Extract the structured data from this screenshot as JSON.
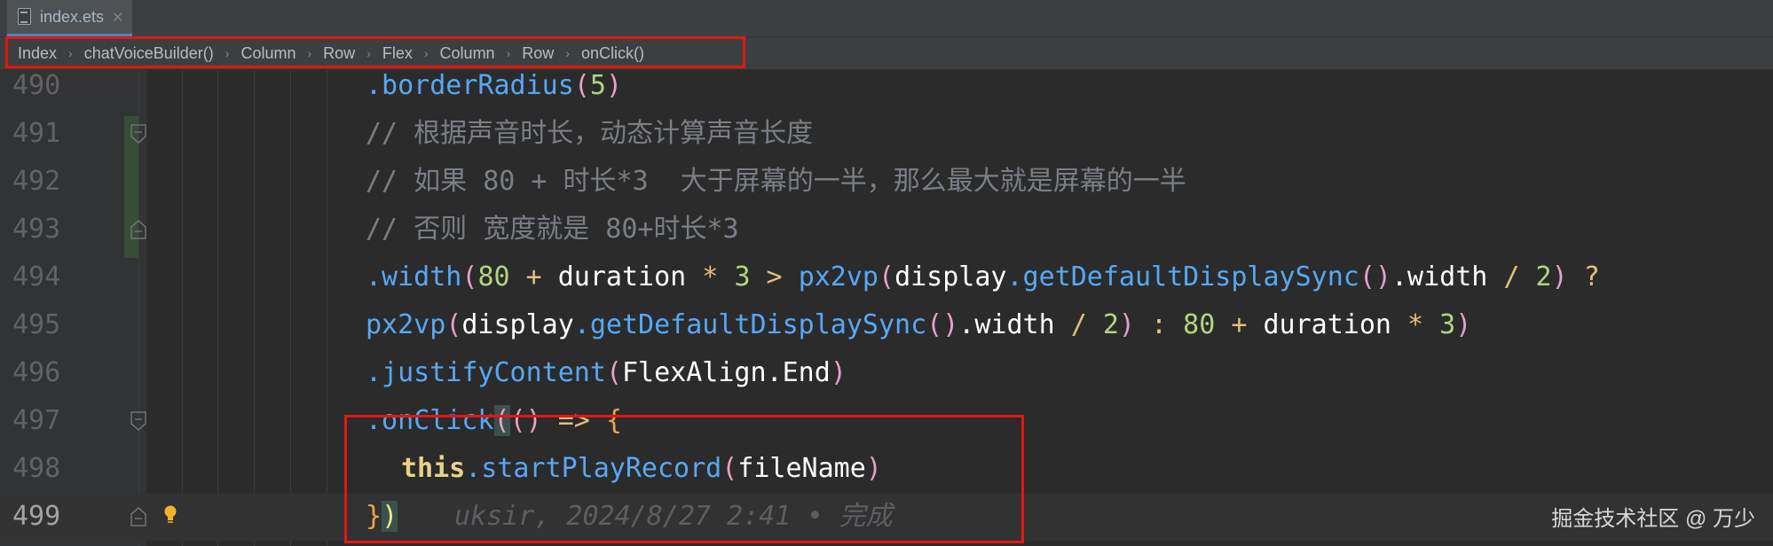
{
  "tab": {
    "label": "index.ets",
    "close_symbol": "✕",
    "icon": "file-icon"
  },
  "breadcrumb": [
    "Index",
    "chatVoiceBuilder()",
    "Column",
    "Row",
    "Flex",
    "Column",
    "Row",
    "onClick()"
  ],
  "breadcrumb_separator": "›",
  "lines": [
    {
      "num": "490"
    },
    {
      "num": "491"
    },
    {
      "num": "492"
    },
    {
      "num": "493"
    },
    {
      "num": "494"
    },
    {
      "num": "495"
    },
    {
      "num": "496"
    },
    {
      "num": "497"
    },
    {
      "num": "498"
    },
    {
      "num": "499"
    }
  ],
  "code": {
    "l490": {
      "method": ".borderRadius",
      "open": "(",
      "num": "5",
      "close": ")"
    },
    "l491": {
      "comment": "// 根据声音时长，动态计算声音长度"
    },
    "l492": {
      "comment": "// 如果 80 + 时长*3  大于屏幕的一半，那么最大就是屏幕的一半"
    },
    "l493": {
      "comment": "// 否则 宽度就是 80+时长*3"
    },
    "l494": {
      "method": ".width",
      "open": "(",
      "n1": "80",
      "plus": " + ",
      "duration": "duration",
      "times": " * ",
      "n2": "3",
      "gt": " > ",
      "px2vp": "px2vp",
      "open2": "(",
      "display": "display",
      "getfn": ".getDefaultDisplaySync",
      "call": "()",
      "width": ".width",
      "div": " / ",
      "n3": "2",
      "close2": ")",
      "q": " ?"
    },
    "l495": {
      "px2vp": "px2vp",
      "open": "(",
      "display": "display",
      "getfn": ".getDefaultDisplaySync",
      "call": "()",
      "width": ".width",
      "div": " / ",
      "n1": "2",
      "close": ")",
      "colon": " : ",
      "n2": "80",
      "plus": " + ",
      "duration": "duration",
      "times": " * ",
      "n3": "3",
      "close2": ")"
    },
    "l496": {
      "method": ".justifyContent",
      "open": "(",
      "arg": "FlexAlign",
      "member": ".End",
      "close": ")"
    },
    "l497": {
      "method": ".onClick",
      "open": "(",
      "args": "()",
      "arrow": " => ",
      "brace": "{"
    },
    "l498": {
      "this": "this",
      "method": ".startPlayRecord",
      "open": "(",
      "arg": "fileName",
      "close": ")"
    },
    "l499": {
      "brace": "}",
      "close": ")",
      "hint": "uksir, 2024/8/27 2:41 • 完成"
    }
  },
  "watermark": "掘金技术社区 @ 万少",
  "colors": {
    "highlight_box": "#e3170f",
    "background": "#2b2b2b"
  }
}
